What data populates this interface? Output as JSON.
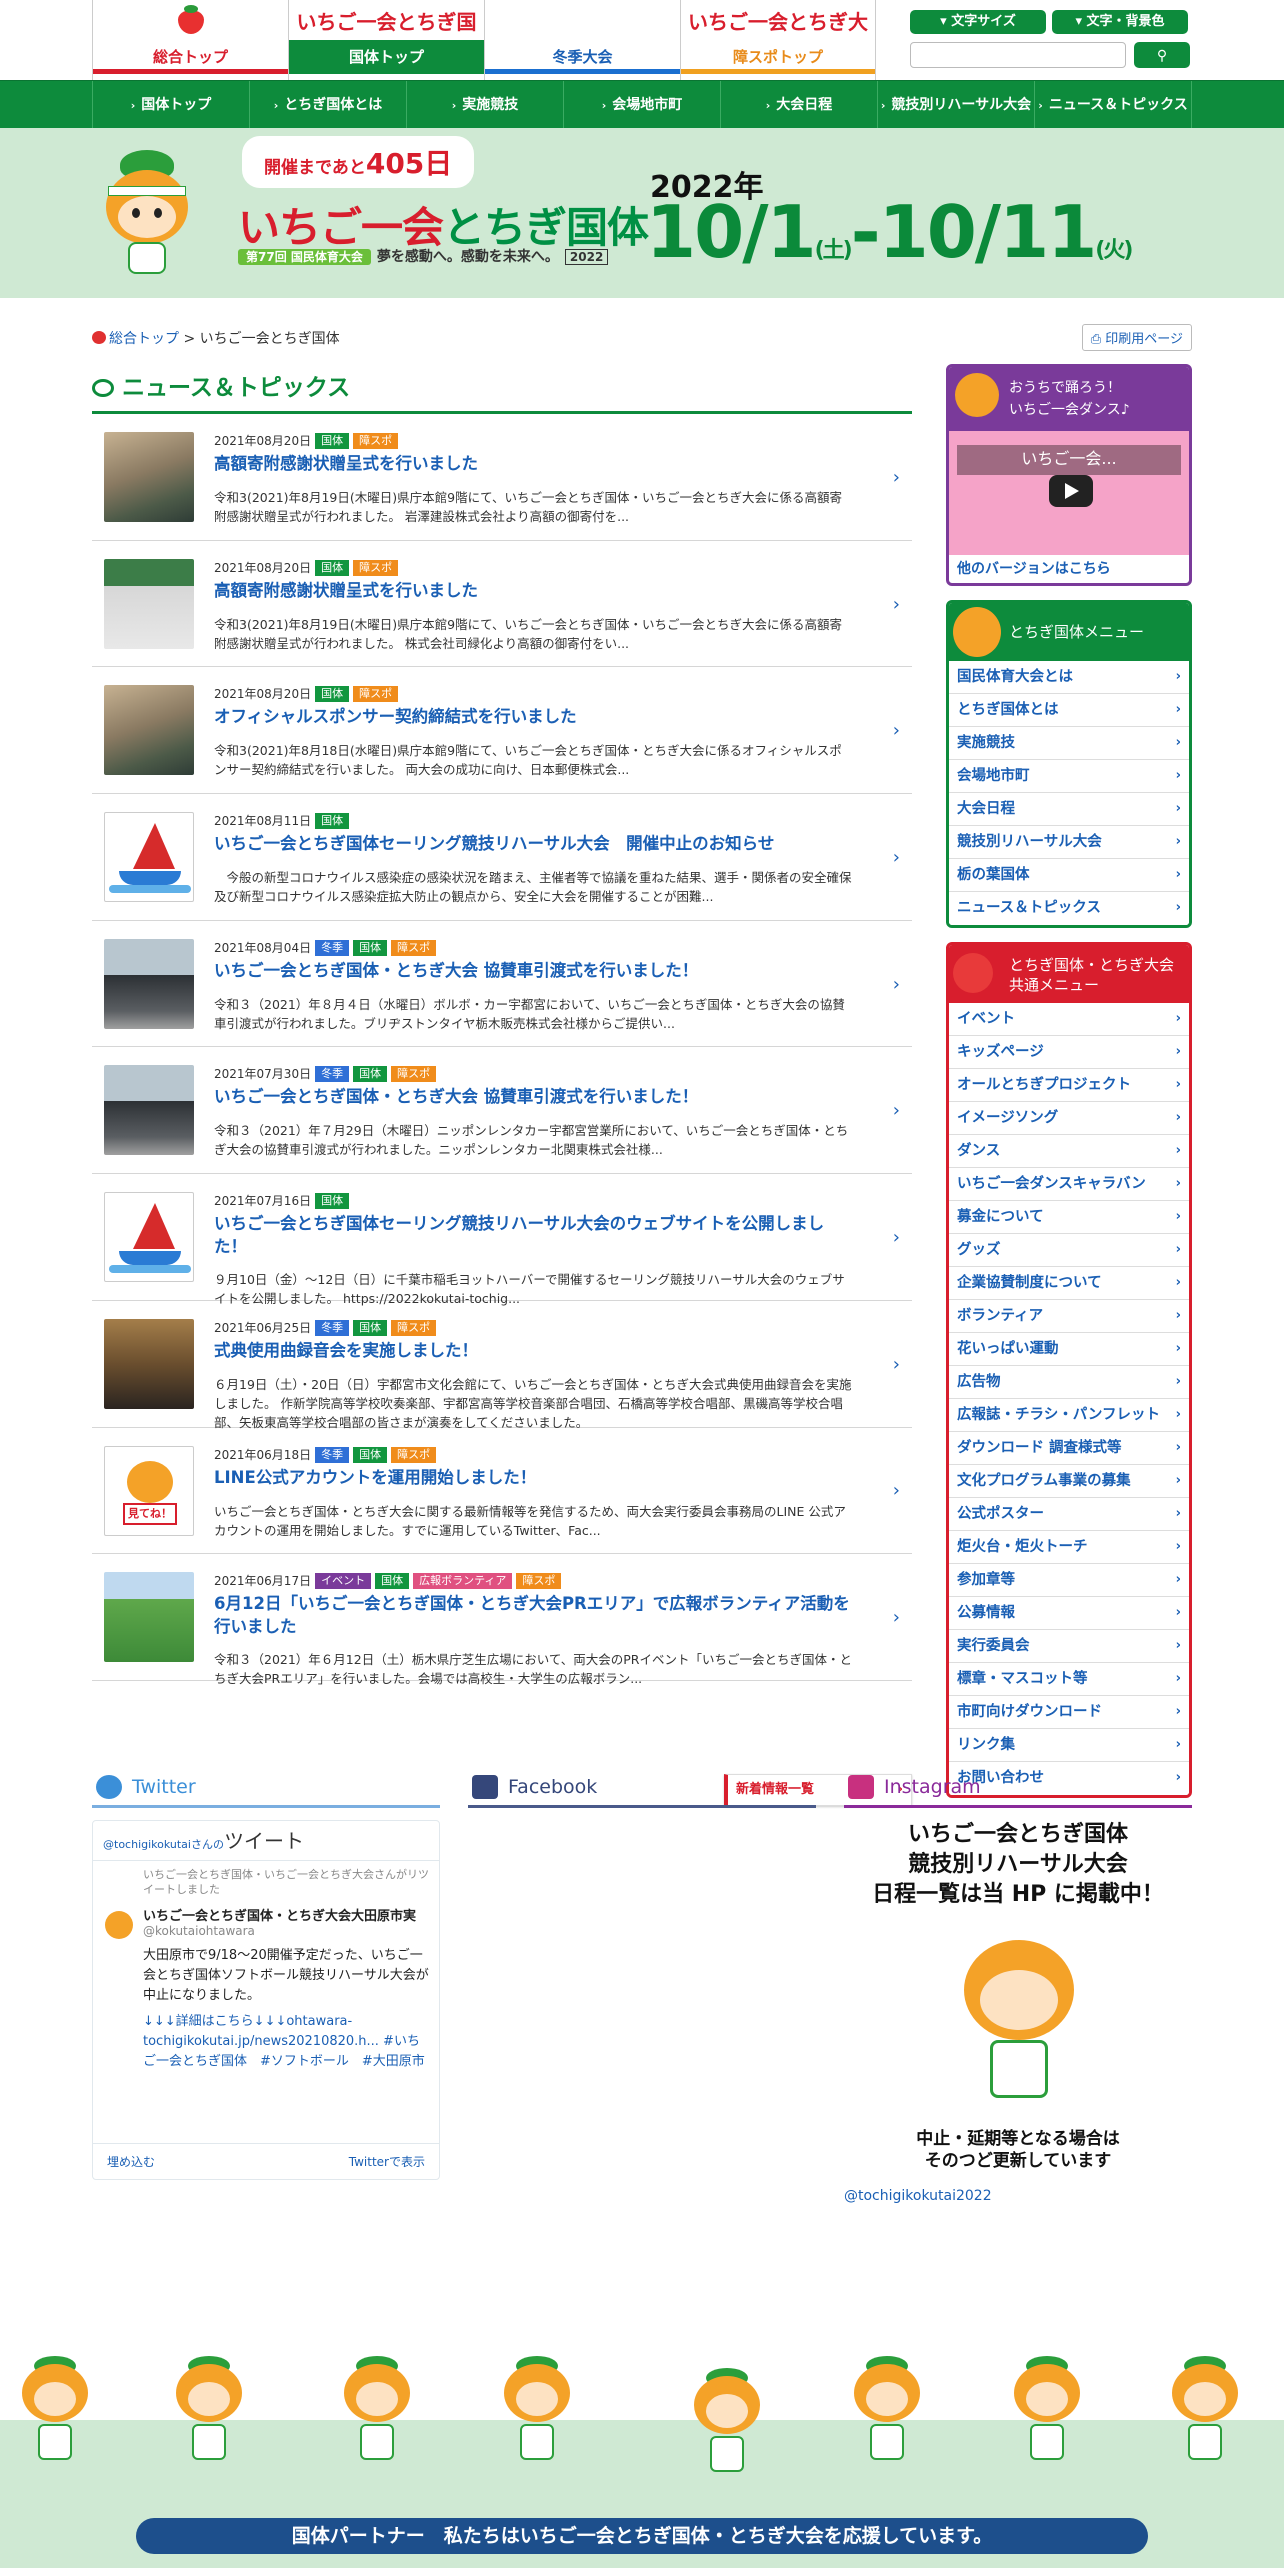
{
  "header": {
    "tabs": [
      {
        "logo": "",
        "label": "総合トップ"
      },
      {
        "logo": "いちご一会とちぎ国体",
        "label": "国体トップ"
      },
      {
        "logo": "",
        "label": "冬季大会"
      },
      {
        "logo": "いちご一会とちぎ大会",
        "label": "障スポトップ"
      }
    ],
    "tools": {
      "font_size": "文字サイズ",
      "color": "文字・背景色",
      "search_placeholder": "",
      "search_icon": "search-icon"
    }
  },
  "global_nav": [
    "国体トップ",
    "とちぎ国体とは",
    "実施競技",
    "会場地市町",
    "大会日程",
    "競技別リハーサル大会",
    "ニュース＆トピックス"
  ],
  "hero": {
    "countdown_prefix": "開催まであと",
    "countdown_value": "405日",
    "logo_main_red": "いちご一会",
    "logo_main_green": "とちぎ",
    "logo_main_red2": "国体",
    "edition": "第77回 国民体育大会",
    "slogan": "夢を感動へ。感動を未来へ。",
    "logo_year": "2022",
    "year": "2022年",
    "start_date": "10/1",
    "start_dow": "(土)",
    "sep": "-",
    "end_date": "10/11",
    "end_dow": "(火)"
  },
  "breadcrumb": {
    "home": "総合トップ",
    "sep": " > ",
    "current": "いちご一会とちぎ国体"
  },
  "print_label": "印刷用ページ",
  "news": {
    "heading": "ニュース＆トピックス",
    "items": [
      {
        "date": "2021年08月20日",
        "tags": [
          "国体",
          "障スポ"
        ],
        "title": "高額寄附感謝状贈呈式を行いました",
        "excerpt": "令和3(2021)年8月19日(木曜日)県庁本館9階にて、いちご一会とちぎ国体・いちご一会とちぎ大会に係る高額寄附感謝状贈呈式が行われました。 岩澤建設株式会社より高額の御寄付を..."
      },
      {
        "date": "2021年08月20日",
        "tags": [
          "国体",
          "障スポ"
        ],
        "title": "高額寄附感謝状贈呈式を行いました",
        "excerpt": "令和3(2021)年8月19日(木曜日)県庁本館9階にて、いちご一会とちぎ国体・いちご一会とちぎ大会に係る高額寄附感謝状贈呈式が行われました。 株式会社司緑化より高額の御寄付をい..."
      },
      {
        "date": "2021年08月20日",
        "tags": [
          "国体",
          "障スポ"
        ],
        "title": "オフィシャルスポンサー契約締結式を行いました",
        "excerpt": "令和3(2021)年8月18日(水曜日)県庁本館9階にて、いちご一会とちぎ国体・とちぎ大会に係るオフィシャルスポンサー契約締結式を行いました。 両大会の成功に向け、日本郵便株式会..."
      },
      {
        "date": "2021年08月11日",
        "tags": [
          "国体"
        ],
        "title": "いちご一会とちぎ国体セーリング競技リハーサル大会　開催中止のお知らせ",
        "excerpt": "　今般の新型コロナウイルス感染症の感染状況を踏まえ、主催者等で協議を重ねた結果、選手・関係者の安全確保及び新型コロナウイルス感染症拡大防止の観点から、安全に大会を開催することが困難..."
      },
      {
        "date": "2021年08月04日",
        "tags": [
          "冬季",
          "国体",
          "障スポ"
        ],
        "title": "いちご一会とちぎ国体・とちぎ大会 協賛車引渡式を行いました！",
        "excerpt": "令和３（2021）年８月４日（水曜日）ボルボ・カー宇都宮において、いちご一会とちぎ国体・とちぎ大会の協賛車引渡式が行われました。ブリヂストンタイヤ栃木販売株式会社様からご提供い..."
      },
      {
        "date": "2021年07月30日",
        "tags": [
          "冬季",
          "国体",
          "障スポ"
        ],
        "title": "いちご一会とちぎ国体・とちぎ大会 協賛車引渡式を行いました！",
        "excerpt": "令和３（2021）年７月29日（木曜日）ニッポンレンタカー宇都宮営業所において、いちご一会とちぎ国体・とちぎ大会の協賛車引渡式が行われました。ニッポンレンタカー北関東株式会社様..."
      },
      {
        "date": "2021年07月16日",
        "tags": [
          "国体"
        ],
        "title": "いちご一会とちぎ国体セーリング競技リハーサル大会のウェブサイトを公開しました！",
        "excerpt": "９月10日（金）～12日（日）に千葉市稲毛ヨットハーバーで開催するセーリング競技リハーサル大会のウェブサイトを公開しました。 https://2022kokutai-tochig..."
      },
      {
        "date": "2021年06月25日",
        "tags": [
          "冬季",
          "国体",
          "障スポ"
        ],
        "title": "式典使用曲録音会を実施しました！",
        "excerpt": "６月19日（土）・20日（日）宇都宮市文化会館にて、いちご一会とちぎ国体・とちぎ大会式典使用曲録音会を実施しました。 作新学院高等学校吹奏楽部、宇都宮高等学校音楽部合唱団、石橋高等学校合唱部、黒磯高等学校合唱部、矢板東高等学校合唱部の皆さまが演奏をしてくださいました。"
      },
      {
        "date": "2021年06月18日",
        "tags": [
          "冬季",
          "国体",
          "障スポ"
        ],
        "title": "LINE公式アカウントを運用開始しました！",
        "excerpt": "いちご一会とちぎ国体・とちぎ大会に関する最新情報等を発信するため、両大会実行委員会事務局のLINE 公式アカウントの運用を開始しました。すでに運用しているTwitter、Fac..."
      },
      {
        "date": "2021年06月17日",
        "tags": [
          "イベント",
          "国体",
          "広報ボランティア",
          "障スポ"
        ],
        "title": "6月12日「いちご一会とちぎ国体・とちぎ大会PRエリア」で広報ボランティア活動を行いました",
        "excerpt": "令和３（2021）年６月12日（土）栃木県庁芝生広場において、両大会のPRイベント「いちご一会とちぎ国体・とちぎ大会PRエリア」を行いました。会場では高校生・大学生の広報ボラン..."
      }
    ],
    "more": "新着情報一覧",
    "thumb_stamp": "見てね！"
  },
  "sidebar": {
    "dance": {
      "title_1": "おうちで踊ろう！",
      "title_2": "いちご一会ダンス♪",
      "video_title": "いちご一会...",
      "link": "他のバージョンはこちら"
    },
    "kokutai_menu": {
      "heading": "とちぎ国体メニュー",
      "items": [
        "国民体育大会とは",
        "とちぎ国体とは",
        "実施競技",
        "会場地市町",
        "大会日程",
        "競技別リハーサル大会",
        "栃の葉国体",
        "ニュース＆トピックス"
      ]
    },
    "common_menu": {
      "heading_1": "とちぎ国体・とちぎ大会",
      "heading_2": "共通メニュー",
      "items": [
        "イベント",
        "キッズページ",
        "オールとちぎプロジェクト",
        "イメージソング",
        "ダンス",
        "いちご一会ダンスキャラバン",
        "募金について",
        "グッズ",
        "企業協賛制度について",
        "ボランティア",
        "花いっぱい運動",
        "広告物",
        "広報誌・チラシ・パンフレット",
        "ダウンロード 調査様式等",
        "文化プログラム事業の募集",
        "公式ポスター",
        "炬火台・炬火トーチ",
        "参加章等",
        "公募情報",
        "実行委員会",
        "標章・マスコット等",
        "市町向けダウンロード",
        "リンク集",
        "お問い合わせ"
      ]
    }
  },
  "social": {
    "twitter": {
      "heading": "Twitter",
      "account": "@tochigikokutai",
      "account_suffix": "さんの",
      "tweets_label": "ツイート",
      "retweeted_by": "いちご一会とちぎ国体・いちご一会とちぎ大会さんがリツイートしました",
      "name": "いちご一会とちぎ国体・とちぎ大会大田原市実",
      "handle": "@kokutaiohtawara",
      "text": "大田原市で9/18～20開催予定だった、いちご一会とちぎ国体ソフトボール競技リハーサル大会が中止になりました。",
      "link": "↓↓↓詳細はこちら↓↓↓ohtawara-tochigikokutai.jp/news20210820.h... #いちご一会とちぎ国体　#ソフトボール　#大田原市",
      "embed": "埋め込む",
      "view": "Twitterで表示"
    },
    "facebook": {
      "heading": "Facebook"
    },
    "instagram": {
      "heading": "Instagram",
      "post_1": "いちご一会とちぎ国体",
      "post_2": "競技別リハーサル大会",
      "post_3": "日程一覧は当 HP に掲載中！",
      "post_4": "中止・延期等となる場合は",
      "post_5": "そのつど更新しています",
      "account": "@tochigikokutai2022"
    }
  },
  "footer": {
    "partner": "国体パートナー　私たちはいちご一会とちぎ国体・とちぎ大会を応援しています。"
  },
  "colors": {
    "green": "#0d8b3c",
    "red": "#d81e2d",
    "blue": "#1a5fb4",
    "orange": "#f08c1b",
    "mint": "#cfe9d3"
  }
}
